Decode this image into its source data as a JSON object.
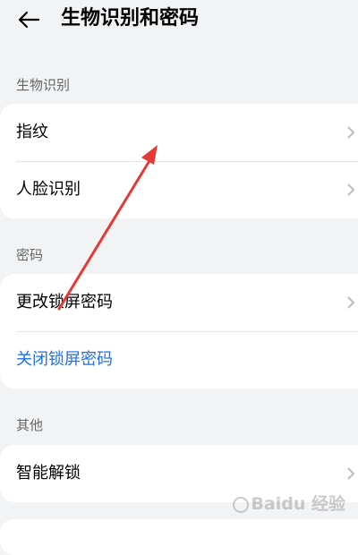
{
  "header": {
    "title": "生物识别和密码"
  },
  "sections": [
    {
      "label": "生物识别",
      "items": [
        {
          "label": "指纹"
        },
        {
          "label": "人脸识别"
        }
      ]
    },
    {
      "label": "密码",
      "items": [
        {
          "label": "更改锁屏密码"
        },
        {
          "label": "关闭锁屏密码"
        }
      ]
    },
    {
      "label": "其他",
      "items": [
        {
          "label": "智能解锁"
        }
      ]
    }
  ],
  "colors": {
    "background": "#f1f3f5",
    "link": "#1f6fe5",
    "annotation_arrow": "#e53935"
  },
  "watermark": {
    "text": "Baidu 经验"
  }
}
